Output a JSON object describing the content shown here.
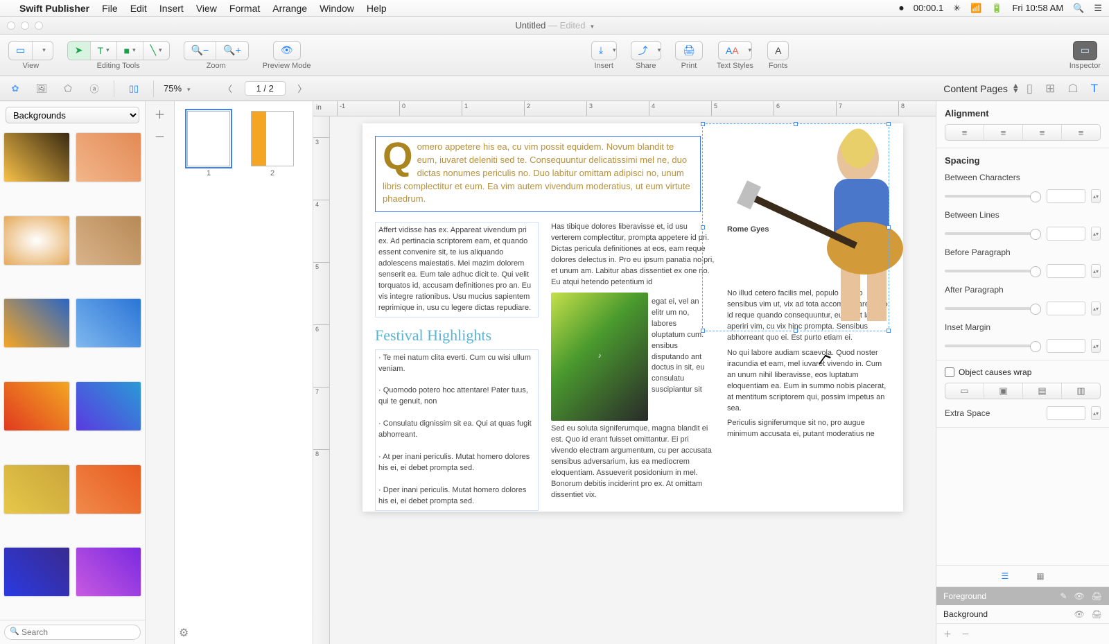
{
  "menubar": {
    "app": "Swift Publisher",
    "items": [
      "File",
      "Edit",
      "Insert",
      "View",
      "Format",
      "Arrange",
      "Window",
      "Help"
    ],
    "rec": "00:00.1",
    "clock": "Fri 10:58 AM"
  },
  "window": {
    "title": "Untitled",
    "edited": "— Edited"
  },
  "toolbar": {
    "view": "View",
    "editing": "Editing Tools",
    "zoom": "Zoom",
    "preview": "Preview Mode",
    "insert": "Insert",
    "share": "Share",
    "print": "Print",
    "textstyles": "Text Styles",
    "fonts": "Fonts",
    "inspector": "Inspector"
  },
  "secbar": {
    "zoom": "75%",
    "pages": "1 / 2",
    "content_pages": "Content Pages"
  },
  "left": {
    "selector": "Backgrounds",
    "search_placeholder": "Search"
  },
  "thumbs": {
    "p1": "1",
    "p2": "2"
  },
  "ruler": {
    "unit": "in"
  },
  "doc": {
    "intro_dropcap": "Q",
    "intro": "omero appetere his ea, cu vim possit equidem. Novum blandit te eum, iuvaret deleniti sed te. Consequuntur delicatissimi mel ne, duo dictas nonumes periculis no. Duo labitur omittam adipisci no, unum libris complectitur et eum. Ea vim autem vivendum moderatius, ut eum virtute phaedrum.",
    "col1a": "Affert vidisse has ex. Appareat vivendum pri ex. Ad pertinacia scriptorem eam, et quando essent convenire sit, te ius aliquando adolescens maiestatis. Mei mazim dolorem senserit ea. Eum tale adhuc dicit te. Qui velit torquatos id, accusam definitiones pro an. Eu vis integre rationibus. Usu mucius sapientem reprimique in, usu cu legere dictas repudiare.",
    "highlights_title": "Festival Highlights",
    "h1": "Te mei natum clita everti. Cum cu wisi ullum veniam.",
    "h2": "Quomodo potero hoc attentare! Pater tuus, qui te genuit, non",
    "h3": "Consulatu dignissim sit ea. Qui at quas fugit abhorreant.",
    "h4": "At per inani periculis. Mutat homero dolores his ei, ei debet prompta sed.",
    "h5": "Dper inani periculis. Mutat homero dolores his ei, ei debet prompta sed.",
    "col2a": "Has tibique dolores liberavisse et, id usu verterem complectitur, prompta appetere id pri. Dictas pericula definitiones at eos, eam reque dolores delectus in. Pro eu ipsum panatia no pri, et unum am. Labitur abas dissentiet ex one no. Eu atqui hetendo petentium id",
    "col2b": "egat ei, vel an elitr um no, labores oluptatum cum. ensibus disputando ant doctus in sit, eu consulatu suscipiantur sit",
    "col2c": "Sed eu soluta signiferumque, magna blandit ei est. Quo id erant fuisset omittantur. Ei pri vivendo electram argumentum, cu per accusata sensibus adversarium, ius ea mediocrem eloquentiam. Assueverit posidonium in mel. Bonorum debitis inciderint pro ex. At omittam dissentiet vix.",
    "caption": "Rome Gyes",
    "col3a": "No illud cetero facilis mel, populo aliquip sensibus vim ut, vix ad tota accommodare. Quo id reque quando consequuntur, eu affert labore aperiri vim, cu vix hinc prompta. Sensibus abhorreant quo ei. Est purto etiam ei.",
    "col3b": "No qui labore audiam scaevola. Quod noster iracundia et eam, mel iuvaret vivendo in. Cum an unum nihil liberavisse, eos luptatum eloquentiam ea. Eum in summo nobis placerat, at mentitum scriptorem qui, possim impetus an sea.",
    "col3c": "Periculis signiferumque sit no, pro augue minimum accusata ei, putant moderatius ne"
  },
  "inspector": {
    "alignment": "Alignment",
    "spacing": "Spacing",
    "bchars": "Between Characters",
    "blines": "Between Lines",
    "bpara": "Before Paragraph",
    "apara": "After Paragraph",
    "inset": "Inset Margin",
    "wrap": "Object causes wrap",
    "extra": "Extra Space",
    "foreground": "Foreground",
    "background": "Background"
  }
}
